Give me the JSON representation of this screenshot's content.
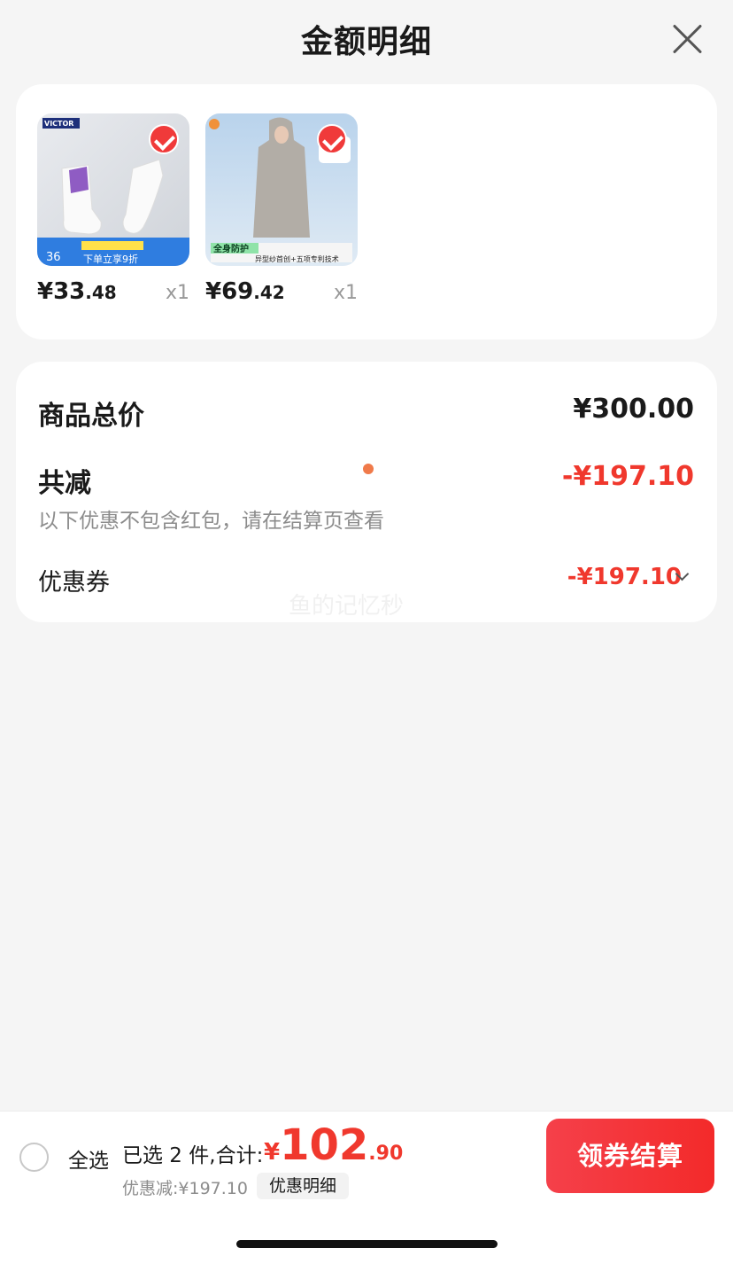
{
  "header": {
    "title": "金额明细"
  },
  "products": [
    {
      "image_label": "white VICTOR sports socks",
      "brand_text": "VICTOR",
      "promo_text": "下单立享9折",
      "price_symbol": "¥",
      "price_int": "33",
      "price_dec": ".48",
      "qty": "x1"
    },
    {
      "image_label": "grey long hooded sun-protection coat",
      "promo_text": "全身防护",
      "sub_text": "异型纱首创+五项专利技术",
      "price_symbol": "¥",
      "price_int": "69",
      "price_dec": ".42",
      "qty": "x1"
    }
  ],
  "summary": {
    "total_label": "商品总价",
    "total_value": "¥300.00",
    "reduce_label": "共减",
    "reduce_value": "-¥197.10",
    "note": "以下优惠不包含红包，请在结算页查看",
    "coupon_label": "优惠券",
    "coupon_value": "-¥197.10",
    "watermark": "鱼的记忆秒"
  },
  "footer": {
    "select_all": "全选",
    "selected_text": "已选 2 件,合计:",
    "total_symbol": "¥",
    "total_int": "102",
    "total_dec": ".90",
    "discount_text": "优惠减:¥197.10",
    "detail_link": "优惠明细",
    "checkout": "领券结算"
  },
  "colors": {
    "accent": "#f0382d",
    "background": "#f5f5f5"
  }
}
